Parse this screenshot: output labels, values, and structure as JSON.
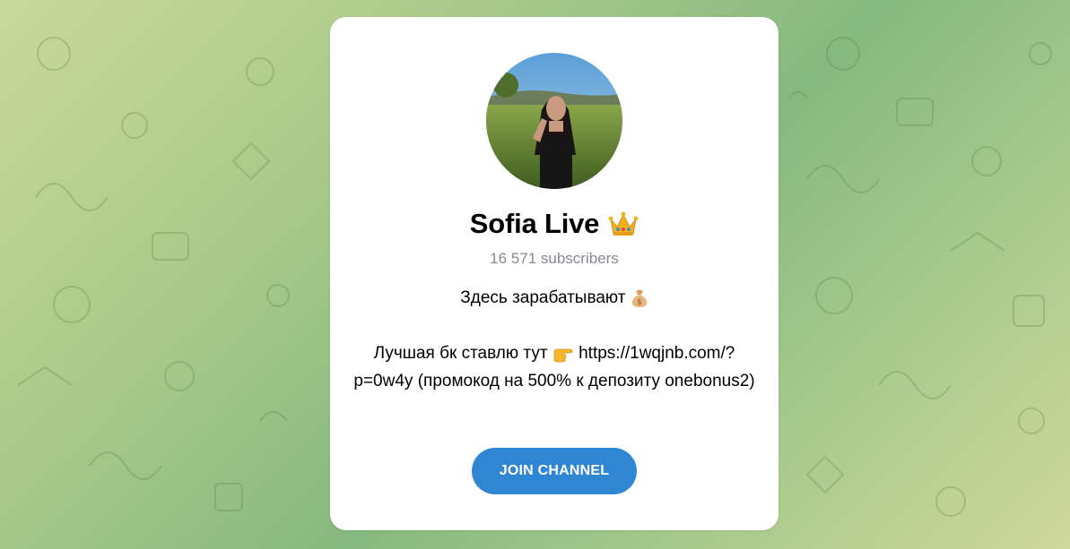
{
  "channel": {
    "name": "Sofia Live",
    "name_badge_icon": "crown-icon",
    "subscribers": "16 571 subscribers",
    "avatar_icon": "channel-avatar-photo"
  },
  "description": {
    "line1": "Здесь зарабатывают",
    "line1_icon": "money-bag-icon",
    "line2_prefix": "Лучшая бк ставлю тут",
    "line2_icon": "pointing-right-icon",
    "line2_link": "https://1wqjnb.com/?p=0w4y",
    "line2_suffix": "(промокод на 500% к депозиту onebonus2)"
  },
  "actions": {
    "join_label": "JOIN CHANNEL",
    "join_color": "#2f86d3"
  }
}
